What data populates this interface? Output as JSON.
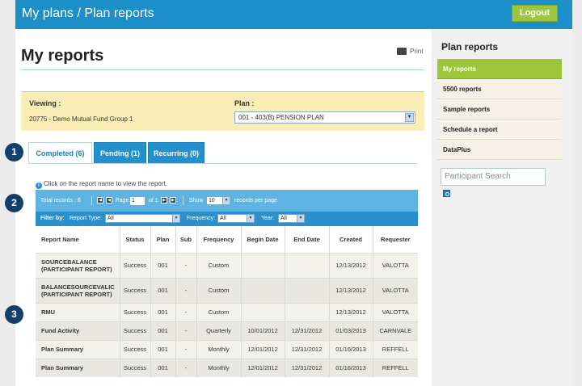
{
  "header": {
    "title": "My plans / Plan reports",
    "logout_label": "Logout"
  },
  "page": {
    "title": "My reports",
    "print_label": "Print"
  },
  "viewing": {
    "viewing_label": "Viewing :",
    "viewing_value": "20775 - Demo Mutual Fund Group 1",
    "plan_label": "Plan :",
    "plan_value": "001 - 403(B) PENSION PLAN"
  },
  "tabs": [
    {
      "label": "Completed (6)",
      "active": true
    },
    {
      "label": "Pending (1)",
      "active": false
    },
    {
      "label": "Recurring (0)",
      "active": false
    }
  ],
  "hint": "Click on the report name to view the report.",
  "pager": {
    "total_records": "Total records : 6",
    "page_label": "Page",
    "page_value": "1",
    "of_label": "of 1",
    "show_label": "Show",
    "show_value": "10",
    "per_page_label": "records per page"
  },
  "filters": {
    "filter_by_label": "Filter by:",
    "report_type_label": "Report Type:",
    "report_type_value": "All",
    "frequency_label": "Frequency:",
    "frequency_value": "All",
    "year_label": "Year:",
    "year_value": "All"
  },
  "table": {
    "columns": [
      "Report Name",
      "Status",
      "Plan",
      "Sub",
      "Frequency",
      "Begin Date",
      "End Date",
      "Created",
      "Requester"
    ],
    "rows": [
      [
        "SOURCEBALANCE (PARTICIPANT REPORT)",
        "Success",
        "001",
        "-",
        "Custom",
        "",
        "",
        "12/13/2012",
        "VALOTTA"
      ],
      [
        "BALANCESOURCEVALIC (PARTICIPANT REPORT)",
        "Success",
        "001",
        "-",
        "Custom",
        "",
        "",
        "12/13/2012",
        "VALOTTA"
      ],
      [
        "RMU",
        "Success",
        "001",
        "-",
        "Custom",
        "",
        "",
        "12/13/2012",
        "VALOTTA"
      ],
      [
        "Fund Activity",
        "Success",
        "001",
        "-",
        "Quarterly",
        "10/01/2012",
        "12/31/2012",
        "01/03/2013",
        "CARNVALE"
      ],
      [
        "Plan Summary",
        "Success",
        "001",
        "-",
        "Monthly",
        "12/01/2012",
        "12/31/2012",
        "01/16/2013",
        "REFFELL"
      ],
      [
        "Plan Summary",
        "Success",
        "001",
        "-",
        "Monthly",
        "12/01/2012",
        "12/31/2012",
        "01/16/2013",
        "REFFELL"
      ]
    ]
  },
  "sidebar": {
    "title": "Plan reports",
    "items": [
      {
        "label": "My reports",
        "active": true
      },
      {
        "label": "5500 reports",
        "active": false
      },
      {
        "label": "Sample reports",
        "active": false
      },
      {
        "label": "Schedule a report",
        "active": false
      },
      {
        "label": "DataPlus",
        "active": false
      }
    ],
    "search_placeholder": "Participant Search"
  },
  "callouts": [
    "1",
    "2",
    "3"
  ],
  "colors": {
    "brand_blue": "#1c8fc8",
    "accent_green": "#9cc63b",
    "callout_navy": "#13406a"
  }
}
